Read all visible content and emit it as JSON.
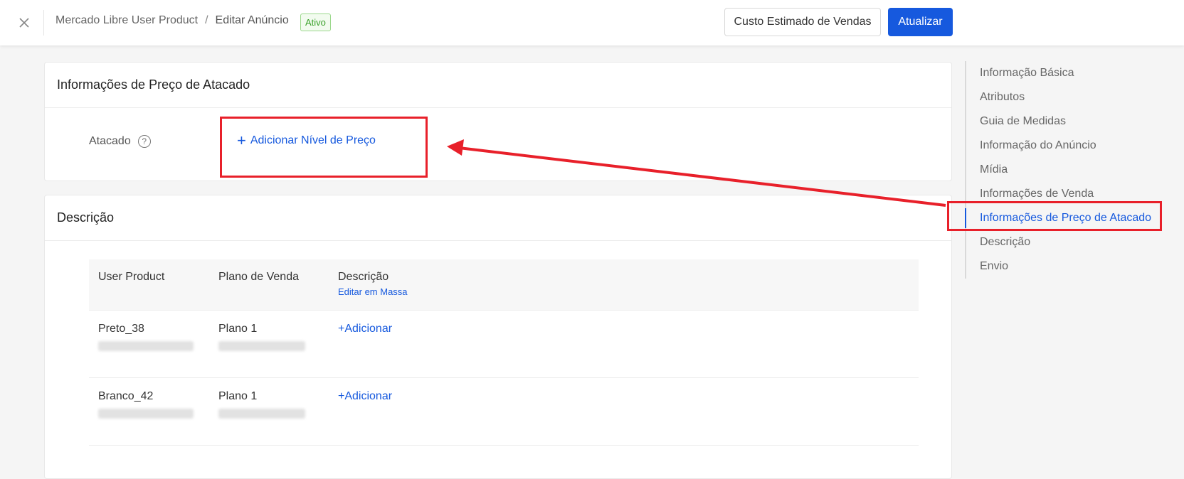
{
  "header": {
    "breadcrumb": {
      "root": "Mercado Libre User Product",
      "separator": "/",
      "current": "Editar Anúncio"
    },
    "status_badge": "Ativo",
    "estimated_cost_button": "Custo Estimado de Vendas",
    "update_button": "Atualizar"
  },
  "wholesale": {
    "title": "Informações de Preço de Atacado",
    "field_label": "Atacado",
    "help_glyph": "?",
    "add_level_plus": "+",
    "add_level_label": "Adicionar Nível de Preço"
  },
  "description": {
    "title": "Descrição",
    "columns": {
      "user_product": "User Product",
      "plan": "Plano de Venda",
      "description": "Descrição",
      "bulk_edit": "Editar em Massa"
    },
    "rows": [
      {
        "name": "Preto_38",
        "plan": "Plano 1",
        "action": "+Adicionar"
      },
      {
        "name": "Branco_42",
        "plan": "Plano 1",
        "action": "+Adicionar"
      }
    ]
  },
  "anchor_nav": {
    "items": [
      "Informação Básica",
      "Atributos",
      "Guia de Medidas",
      "Informação do Anúncio",
      "Mídia",
      "Informações de Venda",
      "Informações de Preço de Atacado",
      "Descrição",
      "Envio"
    ],
    "active_index": 6
  },
  "colors": {
    "primary": "#1659de",
    "annotation": "#e8202a",
    "badge_green": "#3aa12a"
  },
  "icons": {
    "close": "close-icon",
    "help": "help-circle-icon",
    "plus": "plus-icon"
  }
}
